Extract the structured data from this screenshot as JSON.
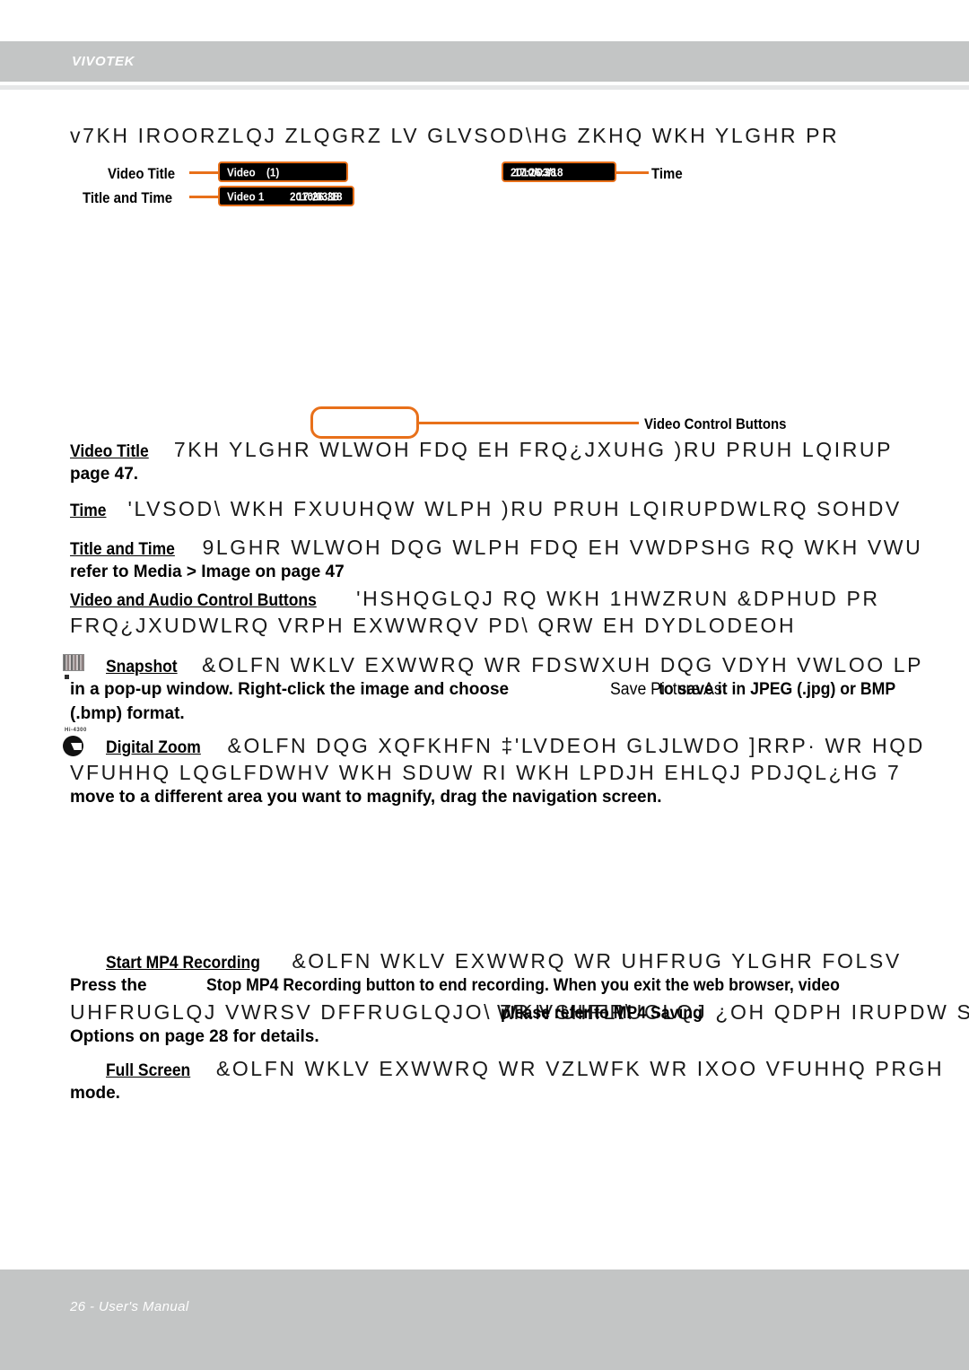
{
  "document": {
    "brand": "VIVOTEK",
    "footer": "26 - User's Manual",
    "page_number": "26"
  },
  "intro": {
    "line": "v7KH IROORZLQJ ZLQGRZ LV GLVSOD\\HG ZKHQ WKH YLGHR PR"
  },
  "diagram": {
    "video_title_label": "Video Title",
    "title_and_time_label": "Title and Time",
    "time_label": "Time",
    "video_control_buttons_label": "Video Control Buttons",
    "osd_video_title": "Video",
    "osd_video_title_overlap": "(1)",
    "osd_title_and_time": "Video 1",
    "osd_title_and_time_overlap": "2010/03/18",
    "osd_title_and_time_overlap2": "17:26:38",
    "osd_time": "2010/03/18",
    "osd_time_overlap": "17:26:38"
  },
  "sections": [
    {
      "id": "video-title",
      "label": "Video Title",
      "cipher_lines": [
        "7KH YLGHR WLWOH FDQ EH FRQ¿JXUHG  )RU PRUH LQIRUP"
      ],
      "solid_lines": [
        "page 47."
      ]
    },
    {
      "id": "time",
      "label": "Time",
      "cipher_lines": [
        "'LVSOD\\ WKH FXUUHQW WLPH  )RU PRUH LQIRUPDWLRQ  SOHDV"
      ],
      "solid_lines": []
    },
    {
      "id": "title-and-time",
      "label": "Title and Time",
      "cipher_lines": [
        "9LGHR WLWOH DQG WLPH FDQ EH VWDPSHG RQ WKH VWU"
      ],
      "solid_lines": [
        "refer to Media > Image on page 47"
      ]
    },
    {
      "id": "video-and-audio-control-buttons",
      "label": "Video and Audio Control Buttons",
      "cipher_lines": [
        "'HSHQGLQJ RQ WKH 1HWZRUN &DPHUD PR",
        "FRQ¿JXUDWLRQ  VRPH EXWWRQV PD\\ QRW EH DYDLODEOH"
      ],
      "solid_lines": []
    },
    {
      "id": "snapshot",
      "label": "Snapshot",
      "icon": "snapshot-icon",
      "cipher_lines": [
        "&OLFN WKLV EXWWRQ WR FDSWXUH DQG VDYH VWLOO LP"
      ],
      "solid_lines": [
        "in a pop-up window. Right-click the image and choose",
        "Save Picture As",
        "to save it in JPEG (.jpg) or BMP",
        "(.bmp) format."
      ]
    },
    {
      "id": "digital-zoom",
      "label": "Digital Zoom",
      "icon": "digital-zoom-icon",
      "icon_caption": "Hi-4300",
      "cipher_lines": [
        "&OLFN DQG XQFKHFN ‡'LVDEOH GLJLWDO ]RRP· WR HQD",
        "VFUHHQ LQGLFDWHV WKH SDUW RI WKH LPDJH EHLQJ PDJQL¿HG  7"
      ],
      "solid_lines": [
        "move to a different area you want to magnify, drag the navigation screen."
      ]
    },
    {
      "id": "start-mp4-recording",
      "label": "Start MP4 Recording",
      "cipher_lines": [
        "&OLFN WKLV EXWWRQ WR UHFRUG YLGHR FOLSV",
        "UHFRUGLQJ VWRSV DFFRUGLQJO\\  7R VSHFLI\\"
      ],
      "solid_lines": [
        "Press the",
        "Stop MP4 Recording button to end recording. When you exit the web browser, video",
        "please refer to MP4 Saving",
        "Options on page 28 for details."
      ],
      "overlap_line": "WKH UHFRUGLQJ ¿OH QDPH IRUPDW  SOHDVH UHIHU WR HVW"
    },
    {
      "id": "full-screen",
      "label": "Full Screen",
      "cipher_lines": [
        "&OLFN WKLV EXWWRQ WR VZLWFK WR IXOO VFUHHQ PRGH"
      ],
      "solid_lines": [
        "mode."
      ]
    }
  ],
  "colors": {
    "band": "#c3c5c5",
    "accent_orange": "#e8701a",
    "rule": "#e6e7e8",
    "text": "#000000"
  }
}
